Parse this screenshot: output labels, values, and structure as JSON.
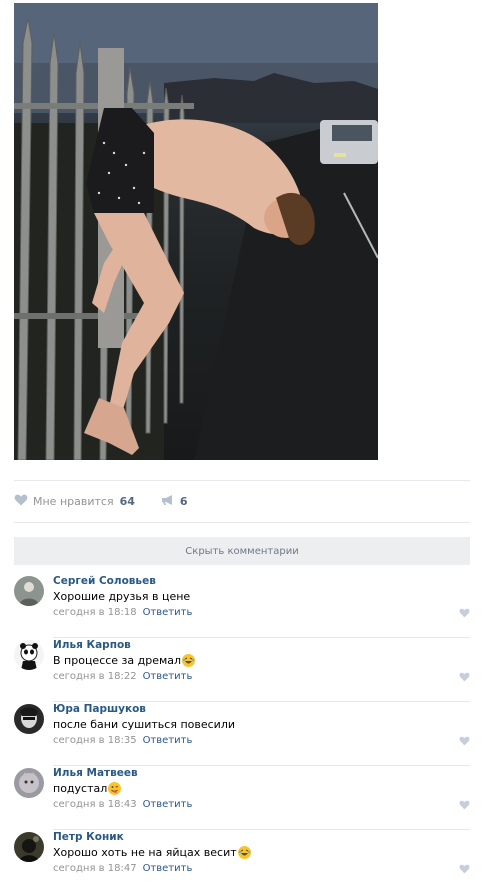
{
  "post": {
    "photo_alt": "",
    "likes_label": "Мне нравится",
    "likes_count": "64",
    "reposts_count": "6",
    "hide_comments_label": "Скрыть комментарии"
  },
  "comments": [
    {
      "author": "Сергей Соловьев",
      "text": "Хорошие друзья в цене",
      "emoji": "",
      "time": "сегодня в 18:18",
      "reply": "Ответить"
    },
    {
      "author": "Илья Карпов",
      "text": "В процессе за дремал",
      "emoji": "laughing-tears",
      "time": "сегодня в 18:22",
      "reply": "Ответить"
    },
    {
      "author": "Юра Паршуков",
      "text": "после бани сушиться повесили",
      "emoji": "",
      "time": "сегодня в 18:35",
      "reply": "Ответить"
    },
    {
      "author": "Илья Матвеев",
      "text": "подустал",
      "emoji": "wink-tongue",
      "time": "сегодня в 18:43",
      "reply": "Ответить"
    },
    {
      "author": "Петр Коник",
      "text": "Хорошо хоть не на яйцах весит",
      "emoji": "laughing-tears",
      "time": "сегодня в 18:47",
      "reply": "Ответить"
    }
  ],
  "colors": {
    "link": "#2a5885",
    "muted": "#939393",
    "bar": "#edeef0"
  }
}
